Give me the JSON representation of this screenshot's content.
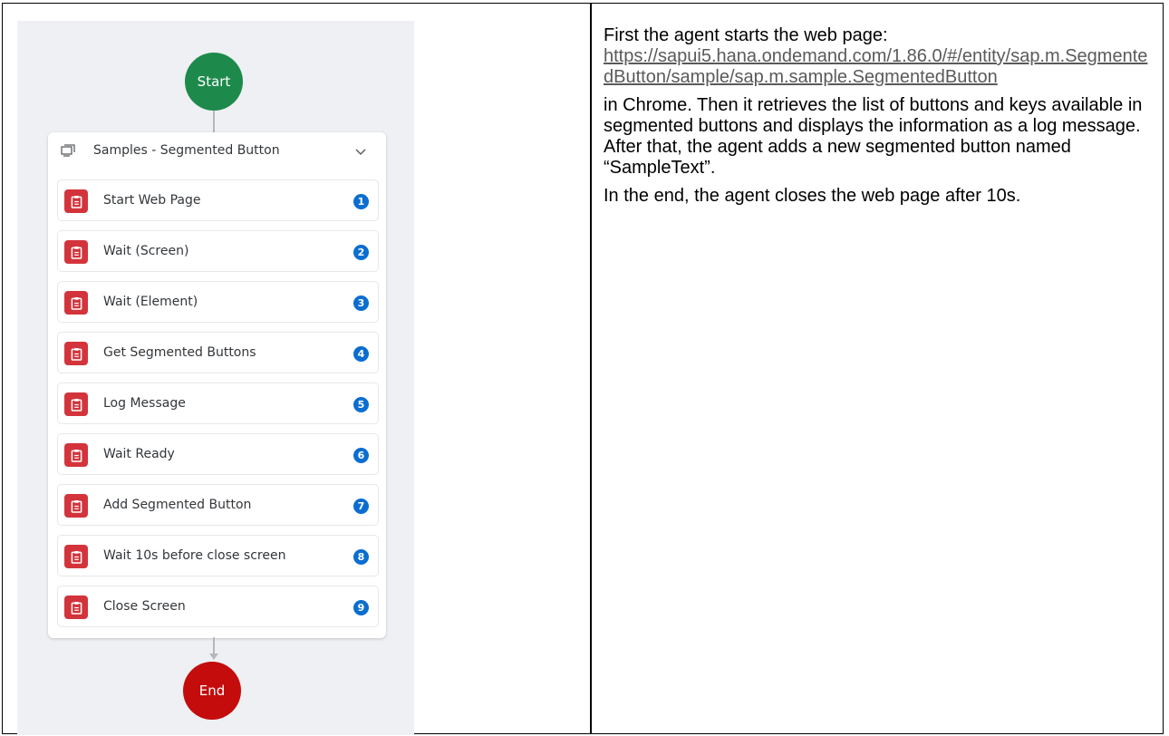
{
  "workflow": {
    "start_label": "Start",
    "end_label": "End",
    "group": {
      "title": "Samples - Segmented Button",
      "icon": "screen-group-icon",
      "toggle_icon": "chevron-down-icon"
    },
    "steps": [
      {
        "label": "Start Web Page",
        "badge": "1",
        "icon": "clipboard-icon"
      },
      {
        "label": "Wait (Screen)",
        "badge": "2",
        "icon": "clipboard-icon"
      },
      {
        "label": "Wait (Element)",
        "badge": "3",
        "icon": "clipboard-icon"
      },
      {
        "label": "Get Segmented Buttons",
        "badge": "4",
        "icon": "clipboard-icon"
      },
      {
        "label": "Log Message",
        "badge": "5",
        "icon": "clipboard-icon"
      },
      {
        "label": "Wait Ready",
        "badge": "6",
        "icon": "clipboard-icon"
      },
      {
        "label": "Add Segmented Button",
        "badge": "7",
        "icon": "clipboard-icon"
      },
      {
        "label": "Wait 10s before close screen",
        "badge": "8",
        "icon": "clipboard-icon"
      },
      {
        "label": "Close Screen",
        "badge": "9",
        "icon": "clipboard-icon"
      }
    ],
    "colors": {
      "start": "#1d8a4c",
      "end": "#c40c0c",
      "step_icon": "#d3343b",
      "badge": "#0a6ed1",
      "canvas": "#eef0f3"
    }
  },
  "description": {
    "intro": "First the agent starts the web page:",
    "link": "https://sapui5.hana.ondemand.com/1.86.0/#/entity/sap.m.SegmentedButton/sample/sap.m.sample.SegmentedButton",
    "body": "in Chrome. Then it retrieves the list of buttons and keys available in segmented buttons and displays the information as a log message. After that, the agent adds a new segmented button named “SampleText”.",
    "closing": "In the end, the agent closes the web page after 10s."
  }
}
